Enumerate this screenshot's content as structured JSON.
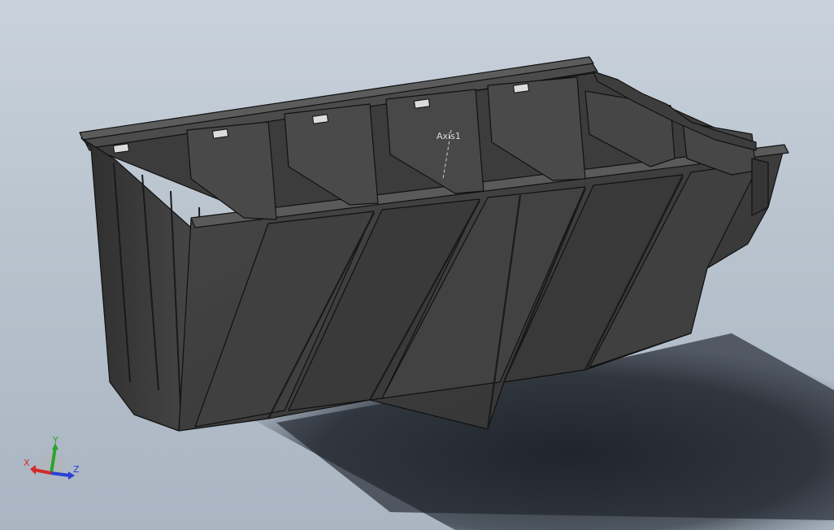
{
  "viewport": {
    "background_top": "#c9d2dc",
    "background_bottom": "#a9b5c2",
    "model_color": "#3a3a3a",
    "model_edge_color": "#111111"
  },
  "annotations": {
    "axis_label": "Axis1"
  },
  "triad": {
    "x_label": "X",
    "y_label": "Y",
    "z_label": "Z",
    "x_color": "#d42b2b",
    "y_color": "#2aa52a",
    "z_color": "#2b3fd4"
  }
}
